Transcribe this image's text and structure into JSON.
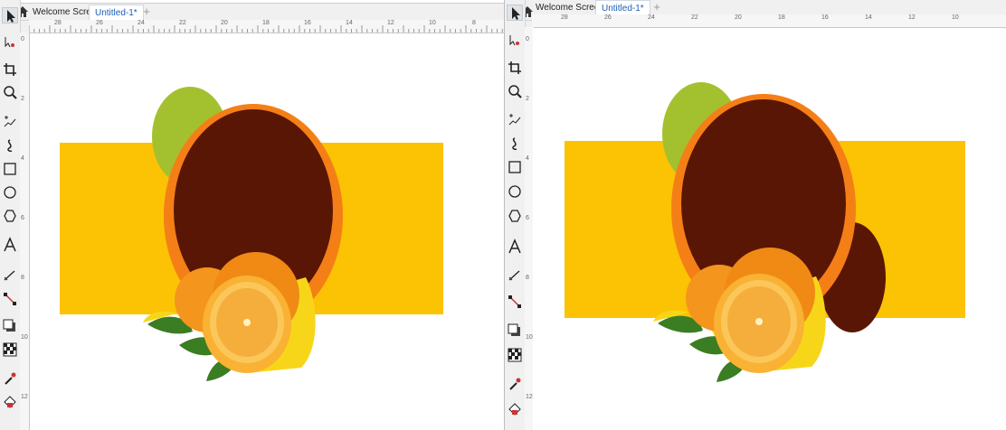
{
  "tabs": {
    "welcome_label": "Welcome Screen",
    "document_label": "Untitled-1*",
    "add_label": "+"
  },
  "ruler": {
    "left_h_labels": [
      "28",
      "26",
      "24",
      "22",
      "20",
      "18",
      "16",
      "14",
      "12",
      "10",
      "8"
    ],
    "right_h_labels": [
      "28",
      "26",
      "24",
      "22",
      "20",
      "18",
      "16",
      "14",
      "12",
      "10"
    ],
    "v_labels": [
      "0",
      "2",
      "4",
      "6",
      "8",
      "10",
      "12"
    ]
  },
  "tools": [
    "pick-tool-icon",
    "shape-tool-icon",
    "crop-tool-icon",
    "zoom-tool-icon",
    "freehand-tool-icon",
    "artistic-media-icon",
    "rectangle-tool-icon",
    "ellipse-tool-icon",
    "polygon-tool-icon",
    "text-tool-icon",
    "parallel-dimension-icon",
    "connector-tool-icon",
    "drop-shadow-icon",
    "transparency-icon",
    "eyedropper-icon",
    "interactive-fill-icon"
  ],
  "colors": {
    "banner": "#fcc204",
    "green_circle": "#a3c12f",
    "orange_ring": "#f57f17",
    "dark_oval": "#5a1605",
    "orange_fruit": "#f4951d",
    "leaf": "#3b7d23"
  }
}
